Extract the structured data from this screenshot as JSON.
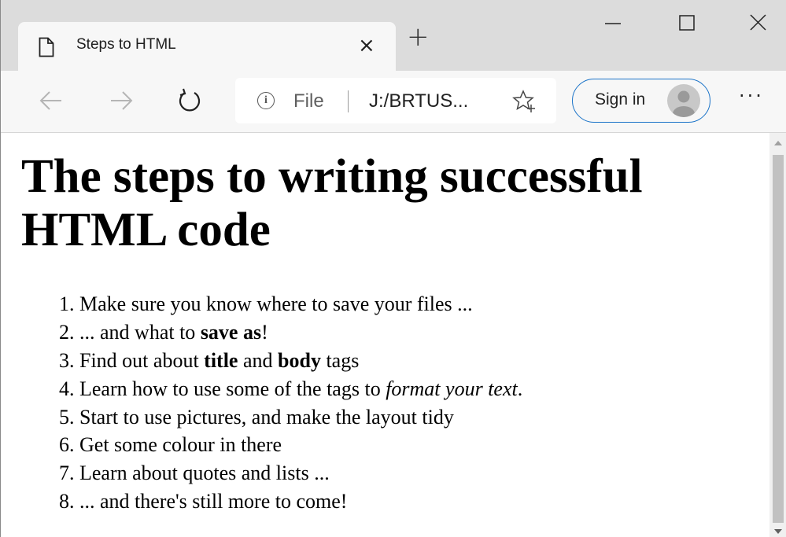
{
  "tab": {
    "title": "Steps to HTML",
    "icon": "document-icon"
  },
  "toolbar": {
    "address_prefix": "File",
    "address_url": "J:/BRTUS...",
    "sign_in_label": "Sign in",
    "more_label": "···"
  },
  "page": {
    "heading": "The steps to writing successful HTML code",
    "items": [
      {
        "number": "1.",
        "parts": [
          {
            "text": "Make sure you know where to save your files ...",
            "style": "normal"
          }
        ]
      },
      {
        "number": "2.",
        "parts": [
          {
            "text": "... and what to ",
            "style": "normal"
          },
          {
            "text": "save as",
            "style": "bold"
          },
          {
            "text": "!",
            "style": "normal"
          }
        ]
      },
      {
        "number": "3.",
        "parts": [
          {
            "text": "Find out about ",
            "style": "normal"
          },
          {
            "text": "title",
            "style": "bold"
          },
          {
            "text": " and ",
            "style": "normal"
          },
          {
            "text": "body",
            "style": "bold"
          },
          {
            "text": " tags",
            "style": "normal"
          }
        ]
      },
      {
        "number": "4.",
        "parts": [
          {
            "text": "Learn how to use some of the tags to ",
            "style": "normal"
          },
          {
            "text": "format your text",
            "style": "italic"
          },
          {
            "text": ".",
            "style": "normal"
          }
        ]
      },
      {
        "number": "5.",
        "parts": [
          {
            "text": "Start to use pictures, and make the layout tidy",
            "style": "normal"
          }
        ]
      },
      {
        "number": "6.",
        "parts": [
          {
            "text": "Get some colour in there",
            "style": "normal"
          }
        ]
      },
      {
        "number": "7.",
        "parts": [
          {
            "text": "Learn about quotes and lists ...",
            "style": "normal"
          }
        ]
      },
      {
        "number": "8.",
        "parts": [
          {
            "text": "... and there's still more to come!",
            "style": "normal"
          }
        ]
      }
    ]
  },
  "colors": {
    "accent": "#1a73c8",
    "tabstrip": "#dcdcdc",
    "toolbar": "#f7f7f7"
  }
}
